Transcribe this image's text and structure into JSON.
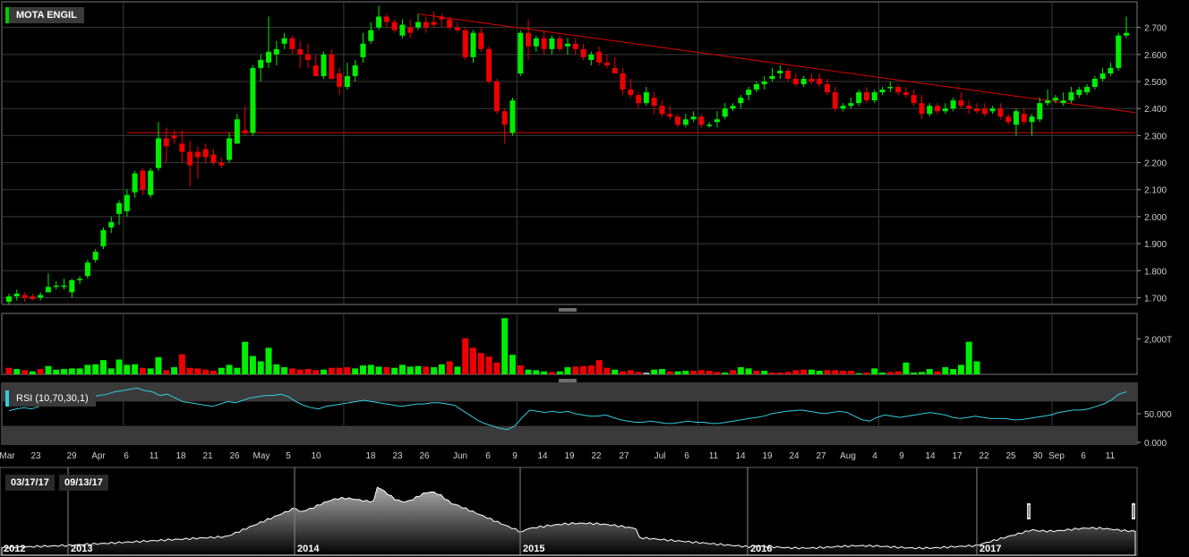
{
  "chart_title": "MOTA ENGIL",
  "rsi_label": "RSI (10,70,30,1)",
  "range_start": "03/17/17",
  "range_end": "09/13/17",
  "colors": {
    "up": "#00ee00",
    "down": "#ee0000",
    "rsi_line": "#33ccdd",
    "accent_green": "#00cc00"
  },
  "chart_data": {
    "type": "candlestick",
    "price_axis_ticks": [
      "2.700",
      "2.600",
      "2.500",
      "2.400",
      "2.300",
      "2.200",
      "2.100",
      "2.000",
      "1.900",
      "1.800",
      "1.700"
    ],
    "volume_axis_ticks": [
      "2,000T"
    ],
    "rsi_axis_ticks": [
      "50.000",
      "0.000"
    ],
    "date_ticks": [
      "Mar",
      "23",
      "29",
      "Apr",
      "6",
      "11",
      "18",
      "21",
      "26",
      "May",
      "5",
      "10",
      "18",
      "23",
      "26",
      "Jun",
      "6",
      "9",
      "14",
      "19",
      "22",
      "27",
      "Jul",
      "6",
      "11",
      "14",
      "19",
      "24",
      "27",
      "Aug",
      "4",
      "9",
      "14",
      "17",
      "22",
      "25",
      "30",
      "Sep",
      "6",
      "11"
    ],
    "overview_years": [
      "2012",
      "2013",
      "2014",
      "2015",
      "2016",
      "2017"
    ],
    "candles": [
      [
        1.685,
        1.715,
        1.675,
        1.705
      ],
      [
        1.705,
        1.73,
        1.69,
        1.715
      ],
      [
        1.71,
        1.72,
        1.685,
        1.7
      ],
      [
        1.705,
        1.715,
        1.69,
        1.695
      ],
      [
        1.7,
        1.72,
        1.69,
        1.71
      ],
      [
        1.72,
        1.79,
        1.72,
        1.74
      ],
      [
        1.74,
        1.76,
        1.73,
        1.745
      ],
      [
        1.74,
        1.77,
        1.73,
        1.745
      ],
      [
        1.72,
        1.77,
        1.7,
        1.765
      ],
      [
        1.765,
        1.78,
        1.75,
        1.77
      ],
      [
        1.78,
        1.84,
        1.77,
        1.83
      ],
      [
        1.84,
        1.88,
        1.83,
        1.87
      ],
      [
        1.89,
        1.96,
        1.88,
        1.95
      ],
      [
        1.96,
        2.0,
        1.94,
        1.98
      ],
      [
        2.01,
        2.06,
        1.97,
        2.05
      ],
      [
        2.02,
        2.1,
        2.0,
        2.08
      ],
      [
        2.09,
        2.17,
        2.07,
        2.16
      ],
      [
        2.17,
        2.18,
        2.08,
        2.1
      ],
      [
        2.08,
        2.18,
        2.07,
        2.17
      ],
      [
        2.18,
        2.35,
        2.17,
        2.29
      ],
      [
        2.29,
        2.33,
        2.2,
        2.26
      ],
      [
        2.3,
        2.32,
        2.27,
        2.29
      ],
      [
        2.27,
        2.32,
        2.2,
        2.24
      ],
      [
        2.24,
        2.28,
        2.11,
        2.19
      ],
      [
        2.24,
        2.26,
        2.14,
        2.22
      ],
      [
        2.25,
        2.27,
        2.2,
        2.22
      ],
      [
        2.23,
        2.25,
        2.19,
        2.2
      ],
      [
        2.2,
        2.22,
        2.18,
        2.19
      ],
      [
        2.21,
        2.31,
        2.2,
        2.29
      ],
      [
        2.27,
        2.38,
        2.27,
        2.36
      ],
      [
        2.32,
        2.41,
        2.3,
        2.31
      ],
      [
        2.31,
        2.56,
        2.3,
        2.55
      ],
      [
        2.55,
        2.6,
        2.5,
        2.58
      ],
      [
        2.57,
        2.74,
        2.55,
        2.61
      ],
      [
        2.6,
        2.65,
        2.56,
        2.62
      ],
      [
        2.64,
        2.68,
        2.62,
        2.66
      ],
      [
        2.66,
        2.67,
        2.6,
        2.62
      ],
      [
        2.62,
        2.65,
        2.55,
        2.6
      ],
      [
        2.6,
        2.64,
        2.55,
        2.58
      ],
      [
        2.56,
        2.6,
        2.52,
        2.52
      ],
      [
        2.52,
        2.61,
        2.51,
        2.6
      ],
      [
        2.6,
        2.62,
        2.51,
        2.51
      ],
      [
        2.53,
        2.55,
        2.45,
        2.48
      ],
      [
        2.48,
        2.57,
        2.47,
        2.52
      ],
      [
        2.52,
        2.58,
        2.5,
        2.56
      ],
      [
        2.59,
        2.68,
        2.57,
        2.64
      ],
      [
        2.65,
        2.72,
        2.64,
        2.69
      ],
      [
        2.7,
        2.78,
        2.69,
        2.74
      ],
      [
        2.74,
        2.75,
        2.7,
        2.72
      ],
      [
        2.72,
        2.73,
        2.68,
        2.69
      ],
      [
        2.67,
        2.73,
        2.66,
        2.71
      ],
      [
        2.7,
        2.73,
        2.66,
        2.68
      ],
      [
        2.7,
        2.75,
        2.69,
        2.72
      ],
      [
        2.72,
        2.74,
        2.68,
        2.7
      ],
      [
        2.72,
        2.76,
        2.7,
        2.71
      ],
      [
        2.74,
        2.75,
        2.7,
        2.73
      ],
      [
        2.73,
        2.74,
        2.69,
        2.7
      ],
      [
        2.7,
        2.72,
        2.68,
        2.69
      ],
      [
        2.69,
        2.7,
        2.58,
        2.59
      ],
      [
        2.59,
        2.69,
        2.57,
        2.68
      ],
      [
        2.68,
        2.7,
        2.61,
        2.62
      ],
      [
        2.62,
        2.63,
        2.49,
        2.5
      ],
      [
        2.5,
        2.51,
        2.38,
        2.39
      ],
      [
        2.39,
        2.4,
        2.27,
        2.34
      ],
      [
        2.31,
        2.44,
        2.3,
        2.43
      ],
      [
        2.53,
        2.69,
        2.52,
        2.68
      ],
      [
        2.68,
        2.73,
        2.58,
        2.63
      ],
      [
        2.63,
        2.67,
        2.61,
        2.66
      ],
      [
        2.66,
        2.69,
        2.6,
        2.62
      ],
      [
        2.62,
        2.67,
        2.6,
        2.66
      ],
      [
        2.66,
        2.67,
        2.61,
        2.62
      ],
      [
        2.63,
        2.66,
        2.6,
        2.64
      ],
      [
        2.64,
        2.66,
        2.6,
        2.62
      ],
      [
        2.62,
        2.64,
        2.58,
        2.59
      ],
      [
        2.58,
        2.61,
        2.56,
        2.6
      ],
      [
        2.61,
        2.63,
        2.56,
        2.57
      ],
      [
        2.57,
        2.6,
        2.55,
        2.56
      ],
      [
        2.55,
        2.59,
        2.53,
        2.53
      ],
      [
        2.53,
        2.55,
        2.45,
        2.47
      ],
      [
        2.47,
        2.51,
        2.44,
        2.45
      ],
      [
        2.45,
        2.46,
        2.4,
        2.42
      ],
      [
        2.42,
        2.48,
        2.41,
        2.46
      ],
      [
        2.44,
        2.46,
        2.38,
        2.41
      ],
      [
        2.41,
        2.43,
        2.37,
        2.38
      ],
      [
        2.38,
        2.41,
        2.36,
        2.37
      ],
      [
        2.37,
        2.38,
        2.33,
        2.34
      ],
      [
        2.34,
        2.38,
        2.33,
        2.36
      ],
      [
        2.36,
        2.39,
        2.35,
        2.37
      ],
      [
        2.37,
        2.38,
        2.33,
        2.34
      ],
      [
        2.34,
        2.35,
        2.33,
        2.34
      ],
      [
        2.35,
        2.39,
        2.33,
        2.36
      ],
      [
        2.37,
        2.42,
        2.36,
        2.4
      ],
      [
        2.4,
        2.42,
        2.39,
        2.41
      ],
      [
        2.42,
        2.45,
        2.4,
        2.44
      ],
      [
        2.45,
        2.48,
        2.43,
        2.47
      ],
      [
        2.47,
        2.5,
        2.46,
        2.49
      ],
      [
        2.49,
        2.52,
        2.47,
        2.5
      ],
      [
        2.51,
        2.55,
        2.5,
        2.52
      ],
      [
        2.53,
        2.56,
        2.51,
        2.54
      ],
      [
        2.54,
        2.55,
        2.5,
        2.51
      ],
      [
        2.51,
        2.53,
        2.48,
        2.49
      ],
      [
        2.49,
        2.52,
        2.48,
        2.51
      ],
      [
        2.51,
        2.53,
        2.49,
        2.5
      ],
      [
        2.51,
        2.53,
        2.48,
        2.49
      ],
      [
        2.49,
        2.51,
        2.45,
        2.46
      ],
      [
        2.46,
        2.48,
        2.39,
        2.4
      ],
      [
        2.4,
        2.42,
        2.39,
        2.41
      ],
      [
        2.41,
        2.44,
        2.4,
        2.42
      ],
      [
        2.42,
        2.47,
        2.41,
        2.46
      ],
      [
        2.46,
        2.48,
        2.42,
        2.43
      ],
      [
        2.43,
        2.47,
        2.42,
        2.46
      ],
      [
        2.46,
        2.48,
        2.45,
        2.47
      ],
      [
        2.48,
        2.5,
        2.46,
        2.48
      ],
      [
        2.48,
        2.49,
        2.45,
        2.46
      ],
      [
        2.46,
        2.48,
        2.44,
        2.45
      ],
      [
        2.45,
        2.47,
        2.41,
        2.42
      ],
      [
        2.42,
        2.45,
        2.36,
        2.38
      ],
      [
        2.38,
        2.42,
        2.37,
        2.41
      ],
      [
        2.41,
        2.42,
        2.38,
        2.39
      ],
      [
        2.39,
        2.42,
        2.38,
        2.4
      ],
      [
        2.4,
        2.44,
        2.39,
        2.43
      ],
      [
        2.43,
        2.46,
        2.4,
        2.41
      ],
      [
        2.41,
        2.43,
        2.38,
        2.4
      ],
      [
        2.4,
        2.42,
        2.38,
        2.39
      ],
      [
        2.4,
        2.42,
        2.37,
        2.38
      ],
      [
        2.39,
        2.41,
        2.38,
        2.4
      ],
      [
        2.4,
        2.42,
        2.36,
        2.37
      ],
      [
        2.37,
        2.38,
        2.34,
        2.35
      ],
      [
        2.34,
        2.4,
        2.3,
        2.39
      ],
      [
        2.38,
        2.4,
        2.34,
        2.35
      ],
      [
        2.35,
        2.38,
        2.3,
        2.37
      ],
      [
        2.36,
        2.44,
        2.35,
        2.42
      ],
      [
        2.42,
        2.47,
        2.41,
        2.43
      ],
      [
        2.43,
        2.45,
        2.42,
        2.44
      ],
      [
        2.42,
        2.46,
        2.41,
        2.43
      ],
      [
        2.43,
        2.48,
        2.42,
        2.46
      ],
      [
        2.45,
        2.48,
        2.44,
        2.47
      ],
      [
        2.46,
        2.49,
        2.45,
        2.48
      ],
      [
        2.48,
        2.52,
        2.47,
        2.51
      ],
      [
        2.51,
        2.55,
        2.5,
        2.53
      ],
      [
        2.53,
        2.57,
        2.52,
        2.55
      ],
      [
        2.55,
        2.68,
        2.54,
        2.67
      ],
      [
        2.67,
        2.74,
        2.66,
        2.68
      ]
    ],
    "volume": [
      [
        0.11,
        "down"
      ],
      [
        0.09,
        "up"
      ],
      [
        0.07,
        "down"
      ],
      [
        0.05,
        "up"
      ],
      [
        0.09,
        "down"
      ],
      [
        0.14,
        "up"
      ],
      [
        0.08,
        "up"
      ],
      [
        0.09,
        "up"
      ],
      [
        0.1,
        "up"
      ],
      [
        0.1,
        "up"
      ],
      [
        0.16,
        "up"
      ],
      [
        0.17,
        "up"
      ],
      [
        0.24,
        "up"
      ],
      [
        0.1,
        "up"
      ],
      [
        0.25,
        "up"
      ],
      [
        0.16,
        "up"
      ],
      [
        0.17,
        "up"
      ],
      [
        0.11,
        "down"
      ],
      [
        0.1,
        "up"
      ],
      [
        0.29,
        "up"
      ],
      [
        0.07,
        "down"
      ],
      [
        0.12,
        "up"
      ],
      [
        0.34,
        "down"
      ],
      [
        0.11,
        "down"
      ],
      [
        0.1,
        "down"
      ],
      [
        0.08,
        "down"
      ],
      [
        0.06,
        "down"
      ],
      [
        0.11,
        "up"
      ],
      [
        0.16,
        "up"
      ],
      [
        0.11,
        "up"
      ],
      [
        0.55,
        "up"
      ],
      [
        0.31,
        "up"
      ],
      [
        0.22,
        "up"
      ],
      [
        0.45,
        "up"
      ],
      [
        0.17,
        "up"
      ],
      [
        0.12,
        "up"
      ],
      [
        0.1,
        "down"
      ],
      [
        0.08,
        "down"
      ],
      [
        0.09,
        "down"
      ],
      [
        0.07,
        "down"
      ],
      [
        0.08,
        "up"
      ],
      [
        0.11,
        "down"
      ],
      [
        0.11,
        "down"
      ],
      [
        0.12,
        "down"
      ],
      [
        0.1,
        "up"
      ],
      [
        0.15,
        "up"
      ],
      [
        0.16,
        "up"
      ],
      [
        0.13,
        "up"
      ],
      [
        0.12,
        "down"
      ],
      [
        0.11,
        "up"
      ],
      [
        0.16,
        "up"
      ],
      [
        0.13,
        "up"
      ],
      [
        0.14,
        "up"
      ],
      [
        0.13,
        "down"
      ],
      [
        0.12,
        "up"
      ],
      [
        0.17,
        "up"
      ],
      [
        0.22,
        "down"
      ],
      [
        0.13,
        "up"
      ],
      [
        0.61,
        "down"
      ],
      [
        0.45,
        "down"
      ],
      [
        0.36,
        "down"
      ],
      [
        0.3,
        "down"
      ],
      [
        0.2,
        "down"
      ],
      [
        0.95,
        "up"
      ],
      [
        0.33,
        "up"
      ],
      [
        0.15,
        "down"
      ],
      [
        0.08,
        "up"
      ],
      [
        0.07,
        "up"
      ],
      [
        0.05,
        "up"
      ],
      [
        0.04,
        "down"
      ],
      [
        0.05,
        "up"
      ],
      [
        0.12,
        "up"
      ],
      [
        0.13,
        "down"
      ],
      [
        0.14,
        "down"
      ],
      [
        0.15,
        "down"
      ],
      [
        0.24,
        "down"
      ],
      [
        0.11,
        "down"
      ],
      [
        0.08,
        "up"
      ],
      [
        0.05,
        "down"
      ],
      [
        0.07,
        "down"
      ],
      [
        0.04,
        "down"
      ],
      [
        0.03,
        "grey"
      ],
      [
        0.08,
        "up"
      ],
      [
        0.09,
        "up"
      ],
      [
        0.05,
        "down"
      ],
      [
        0.05,
        "up"
      ],
      [
        0.06,
        "up"
      ],
      [
        0.06,
        "down"
      ],
      [
        0.07,
        "down"
      ],
      [
        0.06,
        "down"
      ],
      [
        0.04,
        "down"
      ],
      [
        0.03,
        "up"
      ],
      [
        0.07,
        "down"
      ],
      [
        0.12,
        "up"
      ],
      [
        0.1,
        "up"
      ],
      [
        0.06,
        "down"
      ],
      [
        0.06,
        "up"
      ],
      [
        0.03,
        "down"
      ],
      [
        0.03,
        "down"
      ],
      [
        0.04,
        "down"
      ],
      [
        0.07,
        "down"
      ],
      [
        0.08,
        "down"
      ],
      [
        0.08,
        "up"
      ],
      [
        0.06,
        "up"
      ],
      [
        0.07,
        "down"
      ],
      [
        0.07,
        "down"
      ],
      [
        0.06,
        "down"
      ],
      [
        0.06,
        "down"
      ],
      [
        0.02,
        "up"
      ],
      [
        0.03,
        "down"
      ],
      [
        0.1,
        "up"
      ],
      [
        0.03,
        "up"
      ],
      [
        0.04,
        "down"
      ],
      [
        0.05,
        "down"
      ],
      [
        0.2,
        "up"
      ],
      [
        0.03,
        "up"
      ],
      [
        0.04,
        "up"
      ],
      [
        0.09,
        "up"
      ],
      [
        0.05,
        "down"
      ],
      [
        0.12,
        "up"
      ],
      [
        0.09,
        "up"
      ],
      [
        0.16,
        "up"
      ],
      [
        0.55,
        "up"
      ],
      [
        0.22,
        "up"
      ]
    ],
    "rsi": [
      55,
      58,
      60,
      58,
      62,
      66,
      64,
      68,
      70,
      72,
      73,
      78,
      80,
      82,
      86,
      88,
      90,
      92,
      88,
      86,
      80,
      82,
      76,
      70,
      68,
      66,
      64,
      62,
      66,
      70,
      68,
      72,
      76,
      78,
      80,
      80,
      82,
      78,
      70,
      64,
      60,
      58,
      62,
      64,
      66,
      68,
      70,
      72,
      70,
      68,
      66,
      64,
      62,
      64,
      66,
      66,
      68,
      68,
      66,
      64,
      56,
      48,
      40,
      34,
      30,
      26,
      24,
      30,
      44,
      56,
      54,
      52,
      54,
      52,
      54,
      50,
      48,
      46,
      46,
      48,
      44,
      40,
      38,
      36,
      36,
      38,
      36,
      34,
      34,
      36,
      38,
      36,
      36,
      34,
      34,
      36,
      38,
      40,
      42,
      44,
      46,
      50,
      52,
      54,
      55,
      56,
      54,
      52,
      50,
      52,
      54,
      52,
      46,
      40,
      38,
      44,
      48,
      46,
      44,
      46,
      48,
      50,
      52,
      50,
      48,
      44,
      42,
      44,
      46,
      44,
      42,
      42,
      42,
      40,
      40,
      42,
      44,
      46,
      48,
      52,
      54,
      56,
      56,
      58,
      62,
      66,
      72,
      82,
      86
    ]
  }
}
